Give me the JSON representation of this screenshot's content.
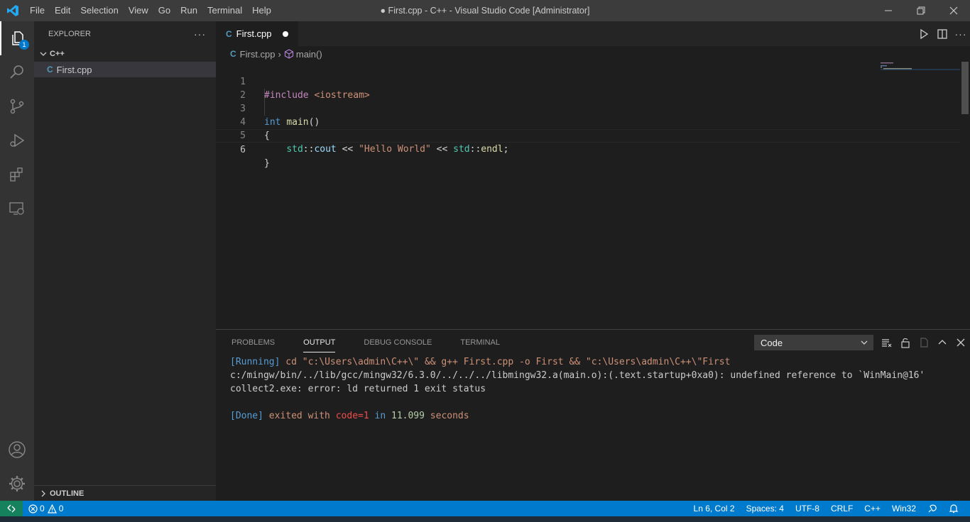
{
  "window": {
    "title": "● First.cpp - C++ - Visual Studio Code [Administrator]",
    "menu": [
      "File",
      "Edit",
      "Selection",
      "View",
      "Go",
      "Run",
      "Terminal",
      "Help"
    ]
  },
  "activity_bar": {
    "explorer_badge": "1"
  },
  "sidebar": {
    "header": "EXPLORER",
    "folder": "C++",
    "files": [
      {
        "name": "First.cpp",
        "icon": "C"
      }
    ],
    "outline_label": "OUTLINE"
  },
  "editor": {
    "tab": {
      "name": "First.cpp",
      "icon": "C"
    },
    "breadcrumb": {
      "file": "First.cpp",
      "symbol": "main()"
    },
    "line_numbers": [
      "1",
      "2",
      "3",
      "4",
      "5",
      "6"
    ],
    "code_lines": [
      "#include <iostream>",
      "",
      "int main()",
      "{",
      "    std::cout << \"Hello World\" << std::endl;",
      "}"
    ]
  },
  "panel": {
    "tabs": [
      "PROBLEMS",
      "OUTPUT",
      "DEBUG CONSOLE",
      "TERMINAL"
    ],
    "active_tab": "OUTPUT",
    "output_source": "Code",
    "output_lines": [
      "[Running] cd \"c:\\Users\\admin\\C++\\\" && g++ First.cpp -o First && \"c:\\Users\\admin\\C++\\\"First",
      "c:/mingw/bin/../lib/gcc/mingw32/6.3.0/../../../libmingw32.a(main.o):(.text.startup+0xa0): undefined reference to `WinMain@16'",
      "collect2.exe: error: ld returned 1 exit status",
      "",
      "[Done] exited with code=1 in 11.099 seconds"
    ]
  },
  "status_bar": {
    "errors": "0",
    "warnings": "0",
    "position": "Ln 6, Col 2",
    "spaces": "Spaces: 4",
    "encoding": "UTF-8",
    "eol": "CRLF",
    "language": "C++",
    "platform": "Win32"
  },
  "colors": {
    "accent": "#007acc",
    "remote": "#16825d",
    "keyword": "#569cd6",
    "string": "#ce9178",
    "error": "#f14c4c"
  }
}
